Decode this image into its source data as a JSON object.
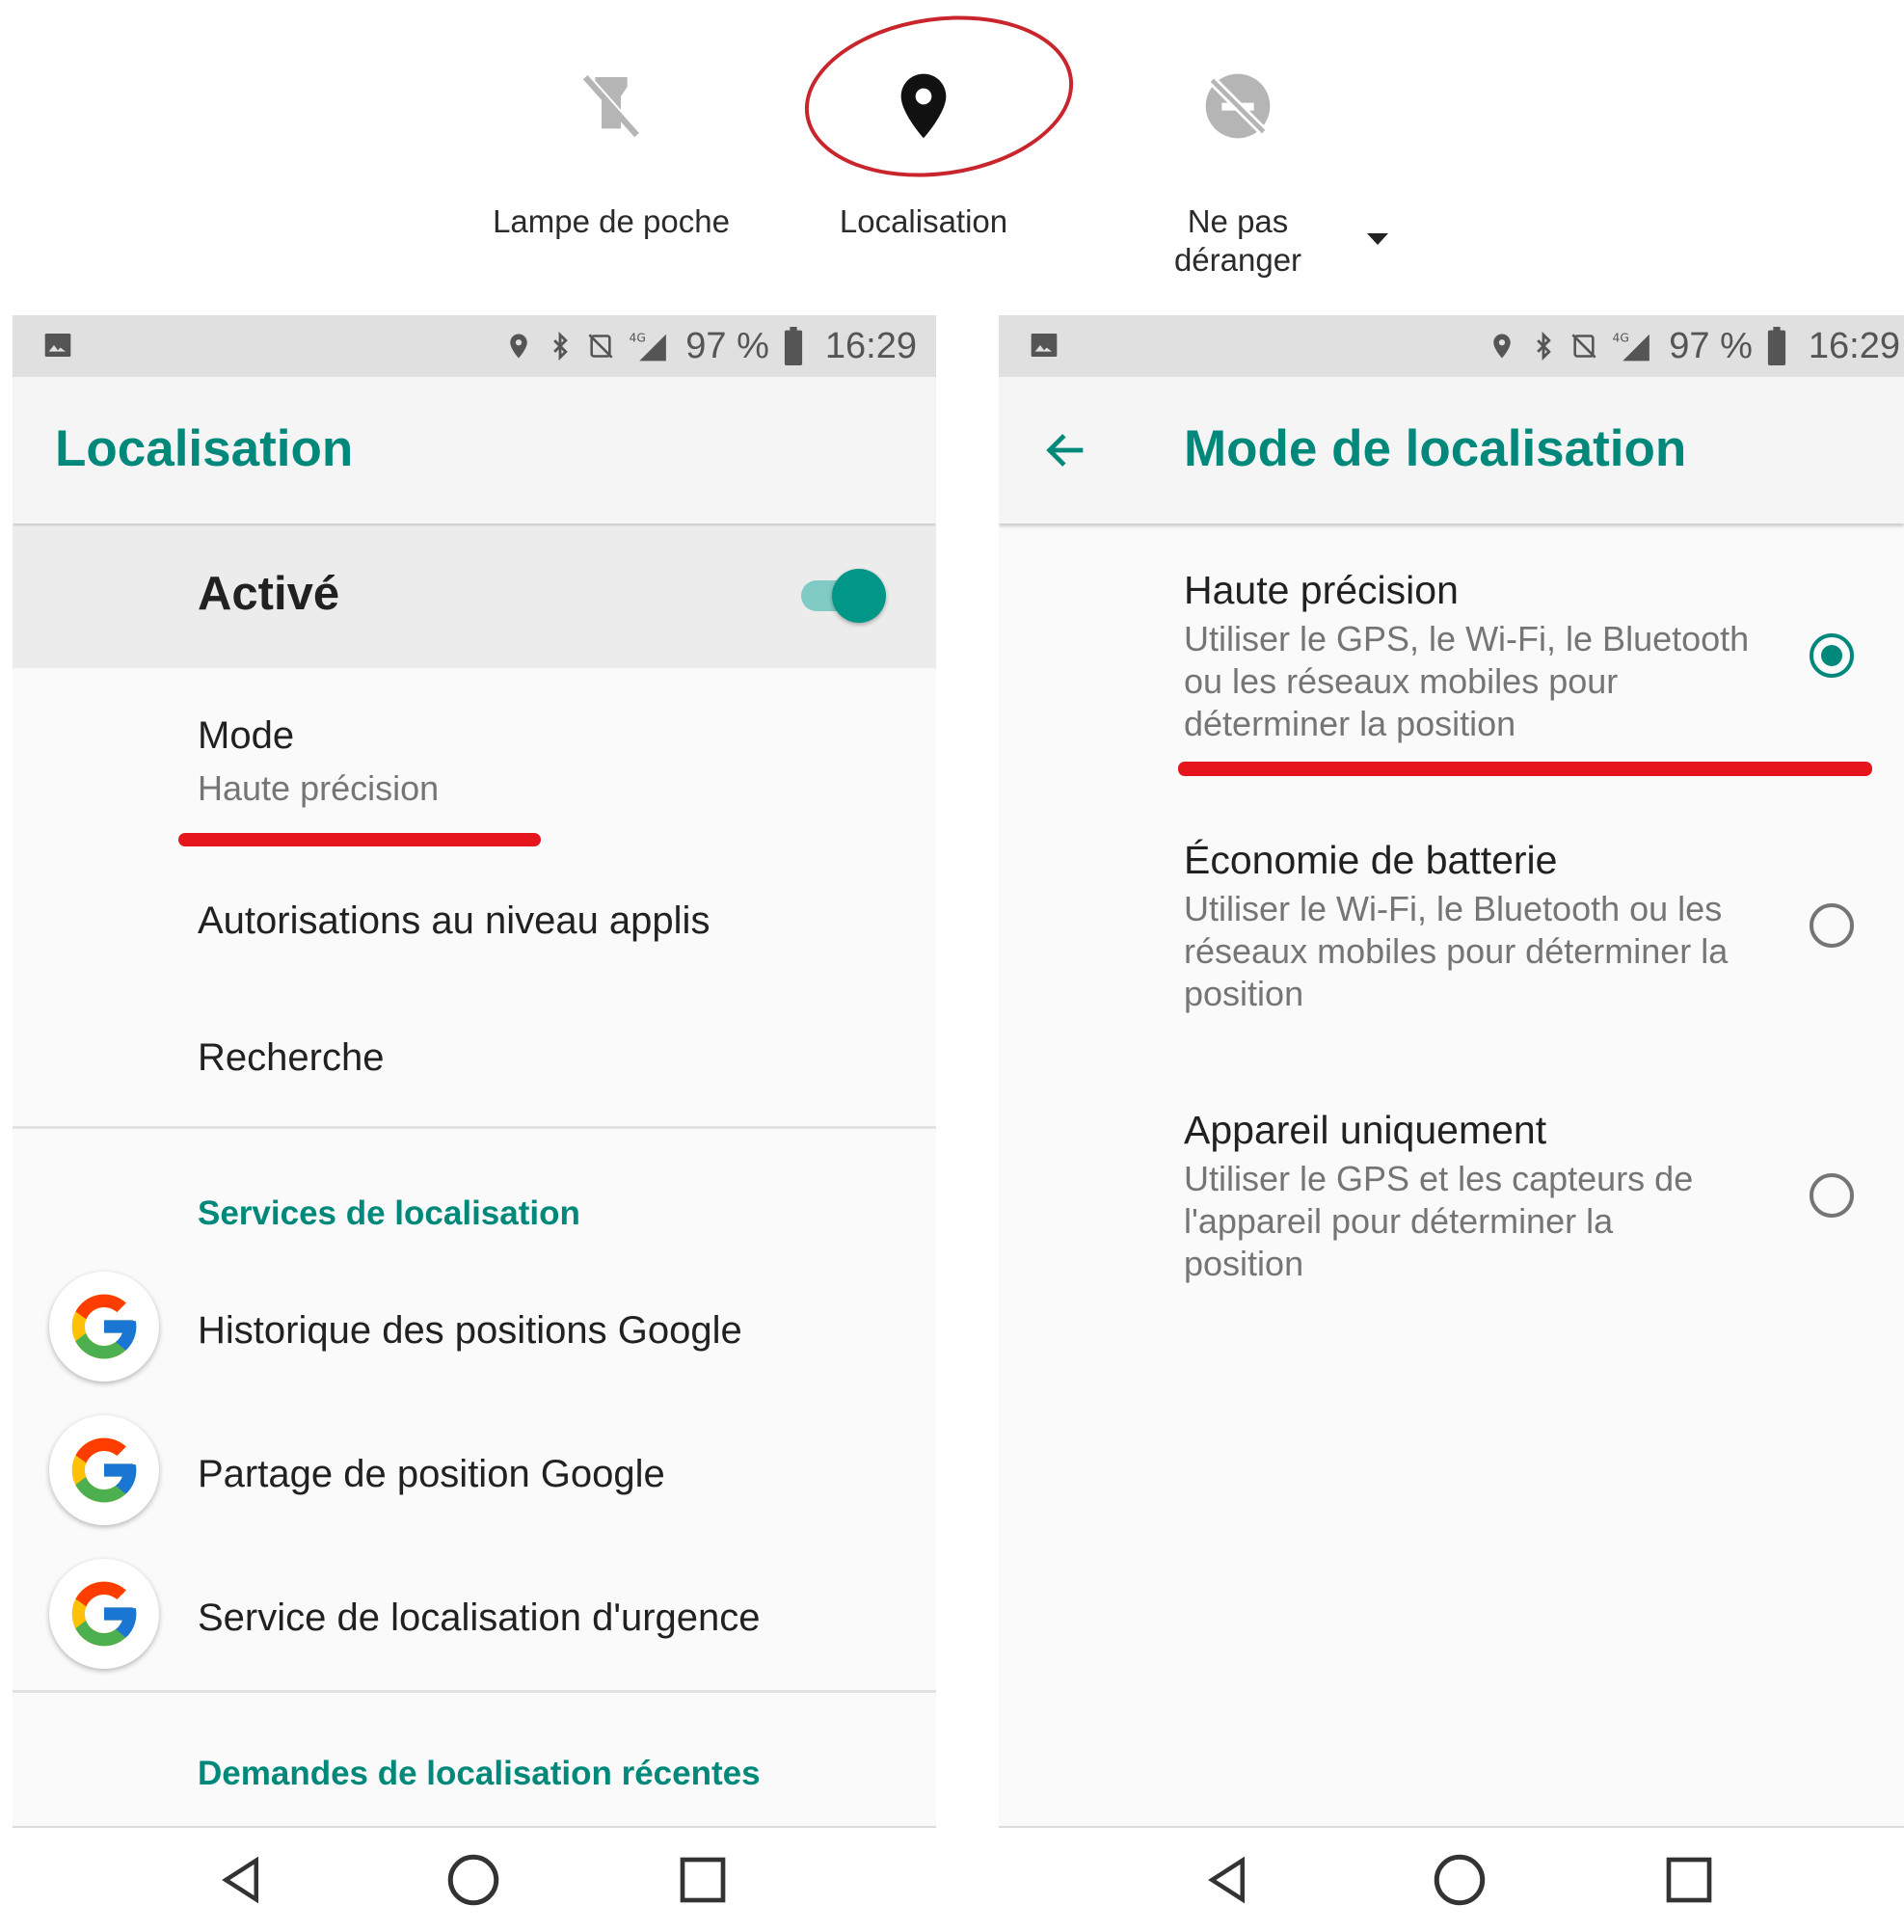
{
  "quick_settings": {
    "tiles": [
      {
        "label": "Lampe de poche",
        "icon": "flashlight-off-icon"
      },
      {
        "label": "Localisation",
        "icon": "location-pin-icon"
      },
      {
        "label": "Ne pas déranger",
        "icon": "do-not-disturb-off-icon"
      }
    ]
  },
  "status_bar": {
    "battery": "97 %",
    "time": "16:29",
    "network": "4G"
  },
  "left_screen": {
    "title": "Localisation",
    "master_switch": {
      "label": "Activé",
      "on": true
    },
    "mode": {
      "title": "Mode",
      "value": "Haute précision"
    },
    "app_permissions": "Autorisations au niveau applis",
    "scanning": "Recherche",
    "services_header": "Services de localisation",
    "services": [
      "Historique des positions Google",
      "Partage de position Google",
      "Service de localisation d'urgence"
    ],
    "recent_header": "Demandes de localisation récentes"
  },
  "right_screen": {
    "title": "Mode de localisation",
    "options": [
      {
        "title": "Haute précision",
        "desc": "Utiliser le GPS, le Wi-Fi, le Bluetooth ou les réseaux mobiles pour déterminer la position",
        "selected": true
      },
      {
        "title": "Économie de batterie",
        "desc": "Utiliser le Wi-Fi, le Bluetooth ou les réseaux mobiles pour déterminer la position",
        "selected": false
      },
      {
        "title": "Appareil uniquement",
        "desc": "Utiliser le GPS et les capteurs de l'appareil pour déterminer la position",
        "selected": false
      }
    ]
  },
  "colors": {
    "accent": "#00897b",
    "highlight": "#e5151d"
  }
}
